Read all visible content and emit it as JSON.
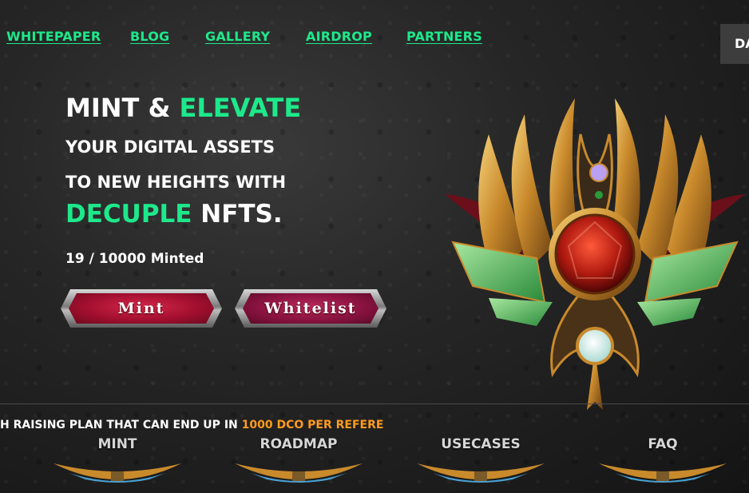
{
  "nav": {
    "items": [
      {
        "label": "WHITEPAPER"
      },
      {
        "label": "BLOG"
      },
      {
        "label": "GALLERY"
      },
      {
        "label": "AIRDROP"
      },
      {
        "label": "PARTNERS"
      }
    ],
    "dapp_label": "DA"
  },
  "hero": {
    "line1_a": "MINT & ",
    "line1_b": "ELEVATE",
    "line2": "YOUR DIGITAL ASSETS",
    "line3": "TO NEW HEIGHTS WITH",
    "line4_a": "DECUPLE",
    "line4_b": " NFTS.",
    "minted_count": "19",
    "minted_total": "10000",
    "minted_text": "19 / 10000 Minted",
    "mint_button": "Mint",
    "whitelist_button": "Whitelist"
  },
  "ticker": {
    "text": "H RAISING PLAN THAT CAN END UP IN ",
    "highlight": "1000 DCO PER REFERE"
  },
  "sections": [
    {
      "label": "MINT"
    },
    {
      "label": "ROADMAP"
    },
    {
      "label": "USECASES"
    },
    {
      "label": "FAQ"
    }
  ],
  "colors": {
    "accent_green": "#1de98b",
    "highlight_orange": "#ff9b1e",
    "button_red": "#a30f2f"
  }
}
